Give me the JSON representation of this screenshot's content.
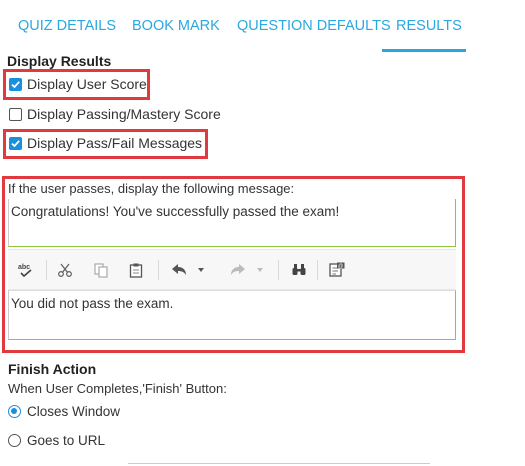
{
  "tabs": [
    {
      "label": "QUIZ DETAILS"
    },
    {
      "label": "BOOK MARK"
    },
    {
      "label": "QUESTION DEFAULTS"
    },
    {
      "label": "RESULTS",
      "active": true
    }
  ],
  "display_results": {
    "heading": "Display Results",
    "options": [
      {
        "label": "Display User Score",
        "checked": true
      },
      {
        "label": "Display Passing/Mastery Score",
        "checked": false
      },
      {
        "label": "Display Pass/Fail Messages",
        "checked": true
      }
    ]
  },
  "messages": {
    "label": "If the user passes, display the following message:",
    "pass_message": "Congratulations!  You've successfully passed the exam!",
    "fail_message": "You did not pass the exam."
  },
  "toolbar": {
    "icons": [
      "spellcheck-icon",
      "cut-icon",
      "copy-icon",
      "paste-icon",
      "undo-icon",
      "redo-icon",
      "find-icon",
      "insert-field-icon"
    ],
    "spellcheck_text": "abc"
  },
  "finish_action": {
    "heading": "Finish Action",
    "subheading": "When User Completes,'Finish' Button:",
    "options": [
      {
        "label": "Closes Window",
        "selected": true
      },
      {
        "label": "Goes to URL",
        "selected": false
      }
    ]
  },
  "colors": {
    "accent": "#29a8e0",
    "checkbox": "#1a8fe0",
    "highlight": "#e0393e",
    "field_border": "#8dc63f"
  }
}
